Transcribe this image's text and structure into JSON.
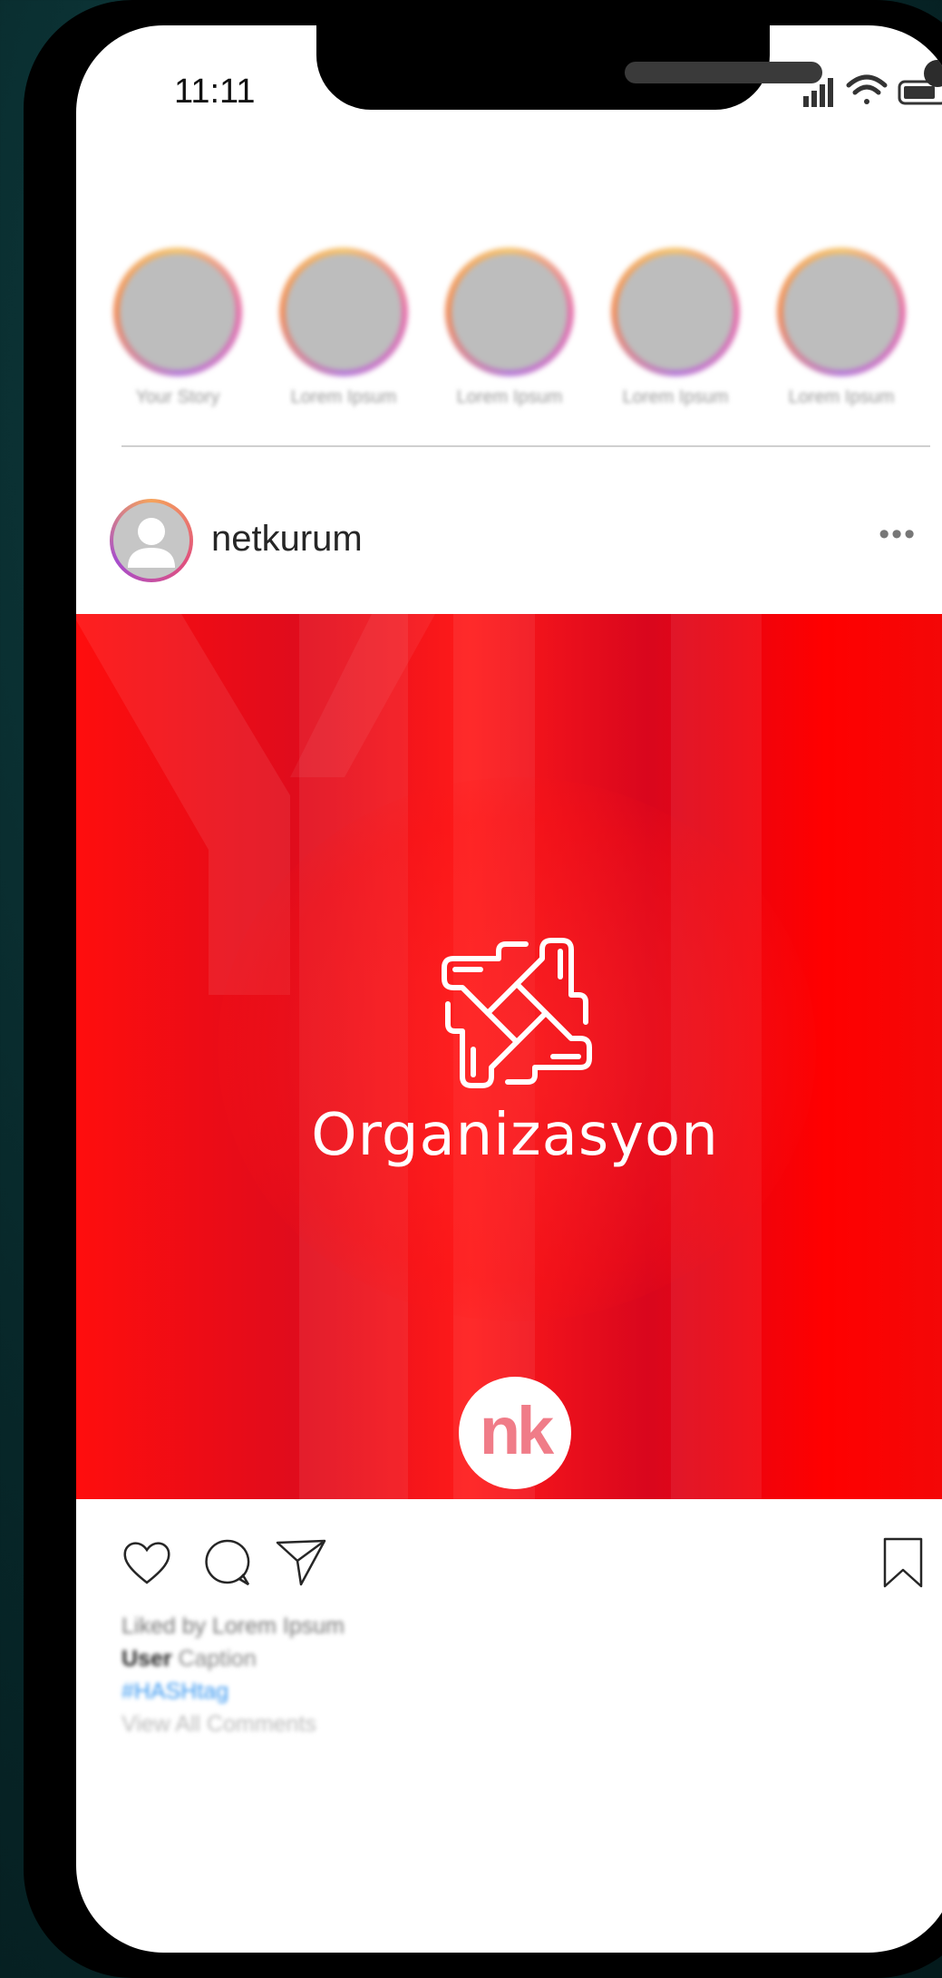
{
  "status_bar": {
    "time": "11:11"
  },
  "stories": [
    {
      "label": "Your Story"
    },
    {
      "label": "Lorem Ipsum"
    },
    {
      "label": "Lorem Ipsum"
    },
    {
      "label": "Lorem Ipsum"
    },
    {
      "label": "Lorem Ipsum"
    }
  ],
  "post": {
    "username": "netkurum",
    "more": "•••",
    "image_text": "Organizasyon",
    "logo_text": "nk",
    "colors": {
      "primary_red": "#ff0000",
      "logo_pink": "#f07c88",
      "hashtag_blue": "#3897f0"
    }
  },
  "caption": {
    "liked_by": "Liked by Lorem Ipsum",
    "user": "User",
    "caption_text": "Caption",
    "hashtag": "#HASHtag",
    "view_comments": "View All Comments"
  },
  "icons": [
    "heart-icon",
    "comment-icon",
    "share-icon",
    "bookmark-icon",
    "signal-icon",
    "wifi-icon",
    "battery-icon",
    "hands-teamwork-icon"
  ]
}
